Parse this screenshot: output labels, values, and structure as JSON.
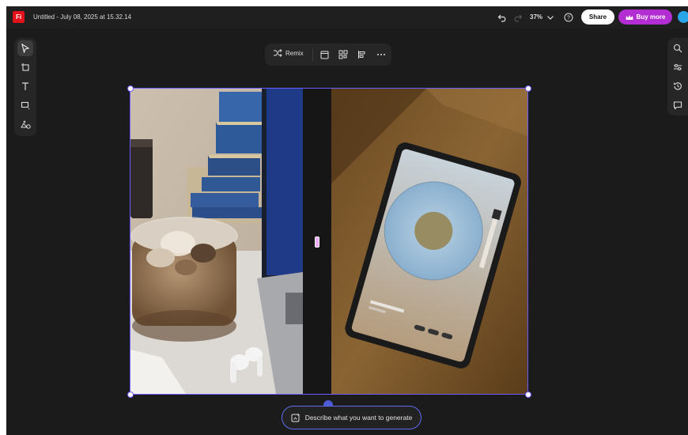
{
  "app": {
    "logo_text": "Fi",
    "document_title": "Untitled - July 08, 2025 at 15.32.14",
    "zoom": "37%",
    "share_label": "Share",
    "buy_label": "Buy more",
    "accent_color": "#b22ed3",
    "selection_color": "#6b5bff"
  },
  "left_toolbar": {
    "tools": [
      {
        "name": "select-tool",
        "icon": "pointer-icon",
        "active": true
      },
      {
        "name": "shape-tool",
        "icon": "frame-icon",
        "active": false
      },
      {
        "name": "text-tool",
        "icon": "text-icon",
        "active": false
      },
      {
        "name": "rectangle-tool",
        "icon": "rectangle-icon",
        "active": false
      },
      {
        "name": "generate-image-tool",
        "icon": "generate-image-icon",
        "active": false
      }
    ]
  },
  "right_toolbar": {
    "tools": [
      {
        "name": "search-tool",
        "icon": "search-icon"
      },
      {
        "name": "adjust-tool",
        "icon": "sliders-icon"
      },
      {
        "name": "history-tool",
        "icon": "history-icon"
      },
      {
        "name": "comments-tool",
        "icon": "comment-icon"
      }
    ]
  },
  "context_toolbar": {
    "remix_label": "Remix",
    "icons": [
      "frame-icon",
      "grid-layout-icon",
      "align-icon",
      "more-icon"
    ]
  },
  "generate_bar": {
    "placeholder": "Describe what you want to generate",
    "icon": "generate-icon"
  }
}
